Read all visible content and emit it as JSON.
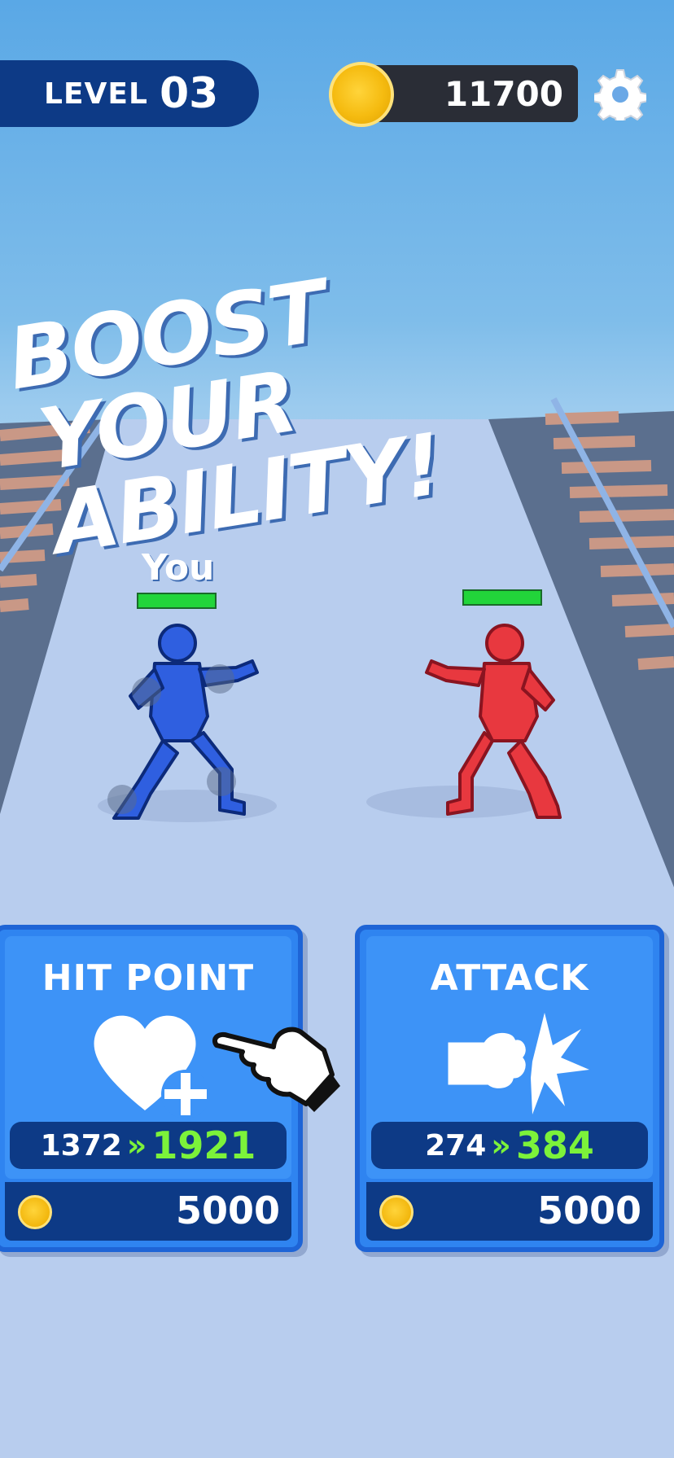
{
  "hud": {
    "level_label": "LEVEL",
    "level_number": "03",
    "coins": "11700",
    "settings_icon": "gear-icon",
    "coin_icon": "coin-icon"
  },
  "headline": {
    "line1": "BOOST",
    "line2": "YOUR ABILITY!"
  },
  "fighters": {
    "player_label": "You",
    "player_color": "#2f5fe0",
    "enemy_color": "#e8383f",
    "health_bar_color": "#22d53a",
    "player_health": 1.0,
    "enemy_health": 1.0
  },
  "upgrades": [
    {
      "title": "HIT POINT",
      "icon": "heart-plus-icon",
      "current": "1372",
      "arrow": "»",
      "next": "1921",
      "price": "5000"
    },
    {
      "title": "ATTACK",
      "icon": "fist-punch-icon",
      "current": "274",
      "arrow": "»",
      "next": "384",
      "price": "5000"
    }
  ],
  "tutorial": {
    "icon": "pointing-hand-icon"
  },
  "colors": {
    "card_blue": "#3d93f7",
    "card_dark": "#0d3a86",
    "accent_green": "#7cf23a",
    "coin_gold": "#f5bb10"
  }
}
